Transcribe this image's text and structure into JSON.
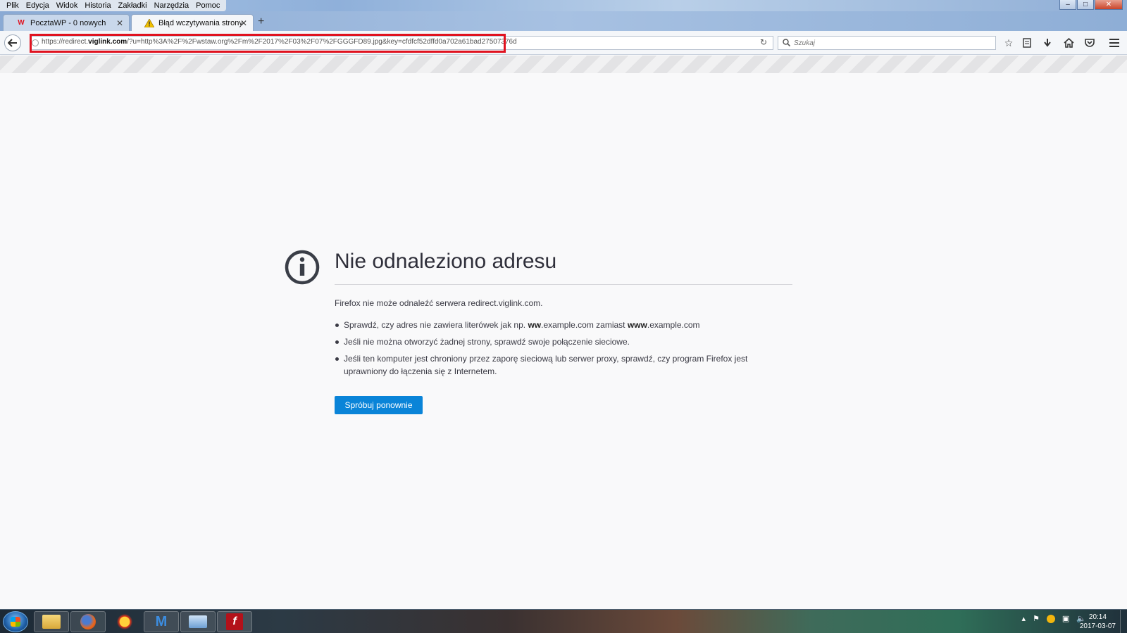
{
  "menu": {
    "items": [
      "Plik",
      "Edycja",
      "Widok",
      "Historia",
      "Zakładki",
      "Narzędzia",
      "Pomoc"
    ]
  },
  "tabs": [
    {
      "label": "PocztaWP - 0 nowych",
      "icon": "wp-logo-icon",
      "active": false
    },
    {
      "label": "Błąd wczytywania strony",
      "icon": "warning-icon",
      "active": true
    }
  ],
  "navbar": {
    "url_prefix": "https://redirect.",
    "url_domain": "viglink.com",
    "url_rest": "/?u=http%3A%2F%2Fwstaw.org%2Fm%2F2017%2F03%2F07%2FGGGFD89.jpg&key=cfdfcf52dffd0a702a61bad27507376d",
    "search_placeholder": "Szukaj"
  },
  "error": {
    "title": "Nie odnaleziono adresu",
    "description": "Firefox nie może odnaleźć serwera redirect.viglink.com.",
    "bullet1_a": "Sprawdź, czy adres nie zawiera literówek jak np. ",
    "bullet1_b": "ww",
    "bullet1_c": ".example.com zamiast ",
    "bullet1_d": "www",
    "bullet1_e": ".example.com",
    "bullet2": "Jeśli nie można otworzyć żadnej strony, sprawdź swoje połączenie sieciowe.",
    "bullet3": "Jeśli ten komputer jest chroniony przez zaporę sieciową lub serwer proxy, sprawdź, czy program Firefox jest uprawniony do łączenia się z Internetem.",
    "retry_label": "Spróbuj ponownie",
    "accent_color": "#0a84d8"
  },
  "taskbar": {
    "time": "20:14",
    "date": "2017-03-07"
  },
  "colors": {
    "highlight_box": "#e0121f"
  }
}
